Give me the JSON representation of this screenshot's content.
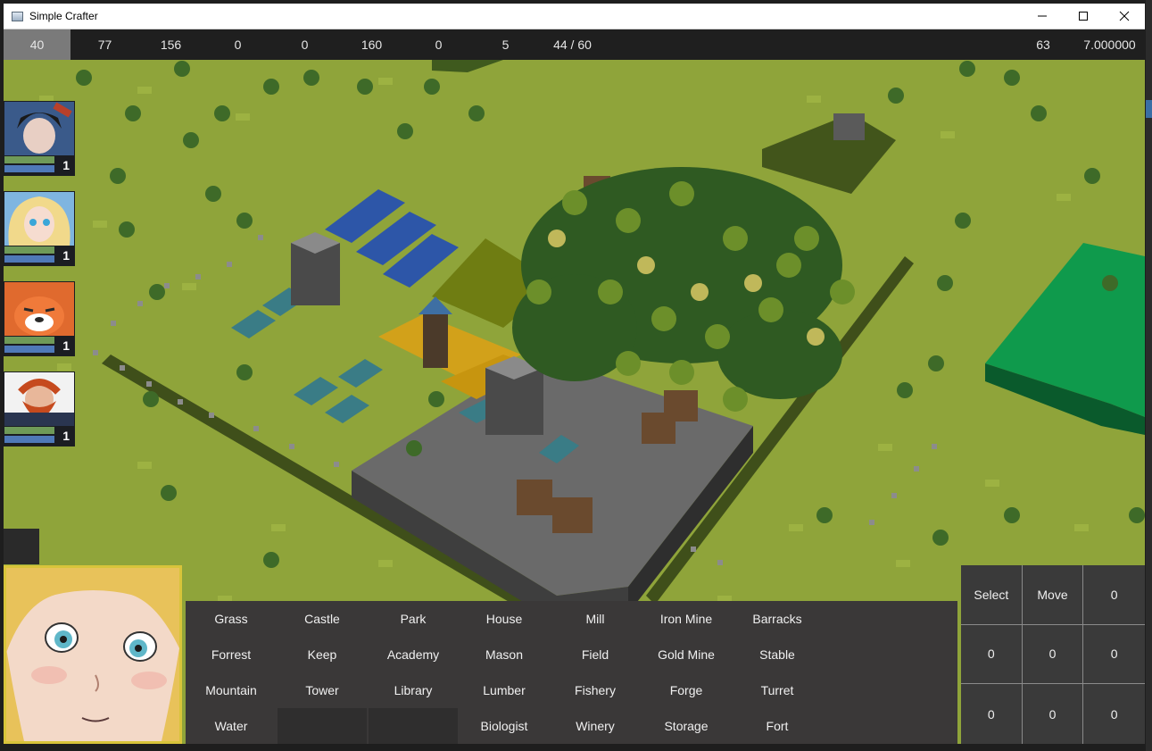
{
  "window": {
    "title": "Simple Crafter",
    "controls": [
      "minimize-icon",
      "maximize-icon",
      "close-icon"
    ]
  },
  "stats": [
    "40",
    "77",
    "156",
    "0",
    "0",
    "160",
    "0",
    "5",
    "44 / 60"
  ],
  "stats_right": [
    "63",
    "7.000000"
  ],
  "party": [
    {
      "portrait": "dark-haired-girl-icon",
      "level": "1"
    },
    {
      "portrait": "blonde-elf-icon",
      "level": "1"
    },
    {
      "portrait": "red-panda-icon",
      "level": "1"
    },
    {
      "portrait": "bearded-warrior-icon",
      "level": "1"
    }
  ],
  "build_menu": {
    "rows": [
      [
        "Grass",
        "Castle",
        "Park",
        "House",
        "Mill",
        "Iron Mine",
        "Barracks"
      ],
      [
        "Forrest",
        "Keep",
        "Academy",
        "Mason",
        "Field",
        "Gold Mine",
        "Stable"
      ],
      [
        "Mountain",
        "Tower",
        "Library",
        "Lumber",
        "Fishery",
        "Forge",
        "Turret"
      ],
      [
        "Water",
        "",
        "",
        "Biologist",
        "Winery",
        "Storage",
        "Fort"
      ]
    ]
  },
  "actions": [
    [
      "Select",
      "Move",
      "0"
    ],
    [
      "0",
      "0",
      "0"
    ],
    [
      "0",
      "0",
      "0"
    ]
  ],
  "colors": {
    "grass": "#8fa43a",
    "stats_active": "#7a7a7a",
    "portrait_border": "#d8c43a",
    "hp_bar": "#6f9a58",
    "mp_bar": "#4f79b8"
  }
}
